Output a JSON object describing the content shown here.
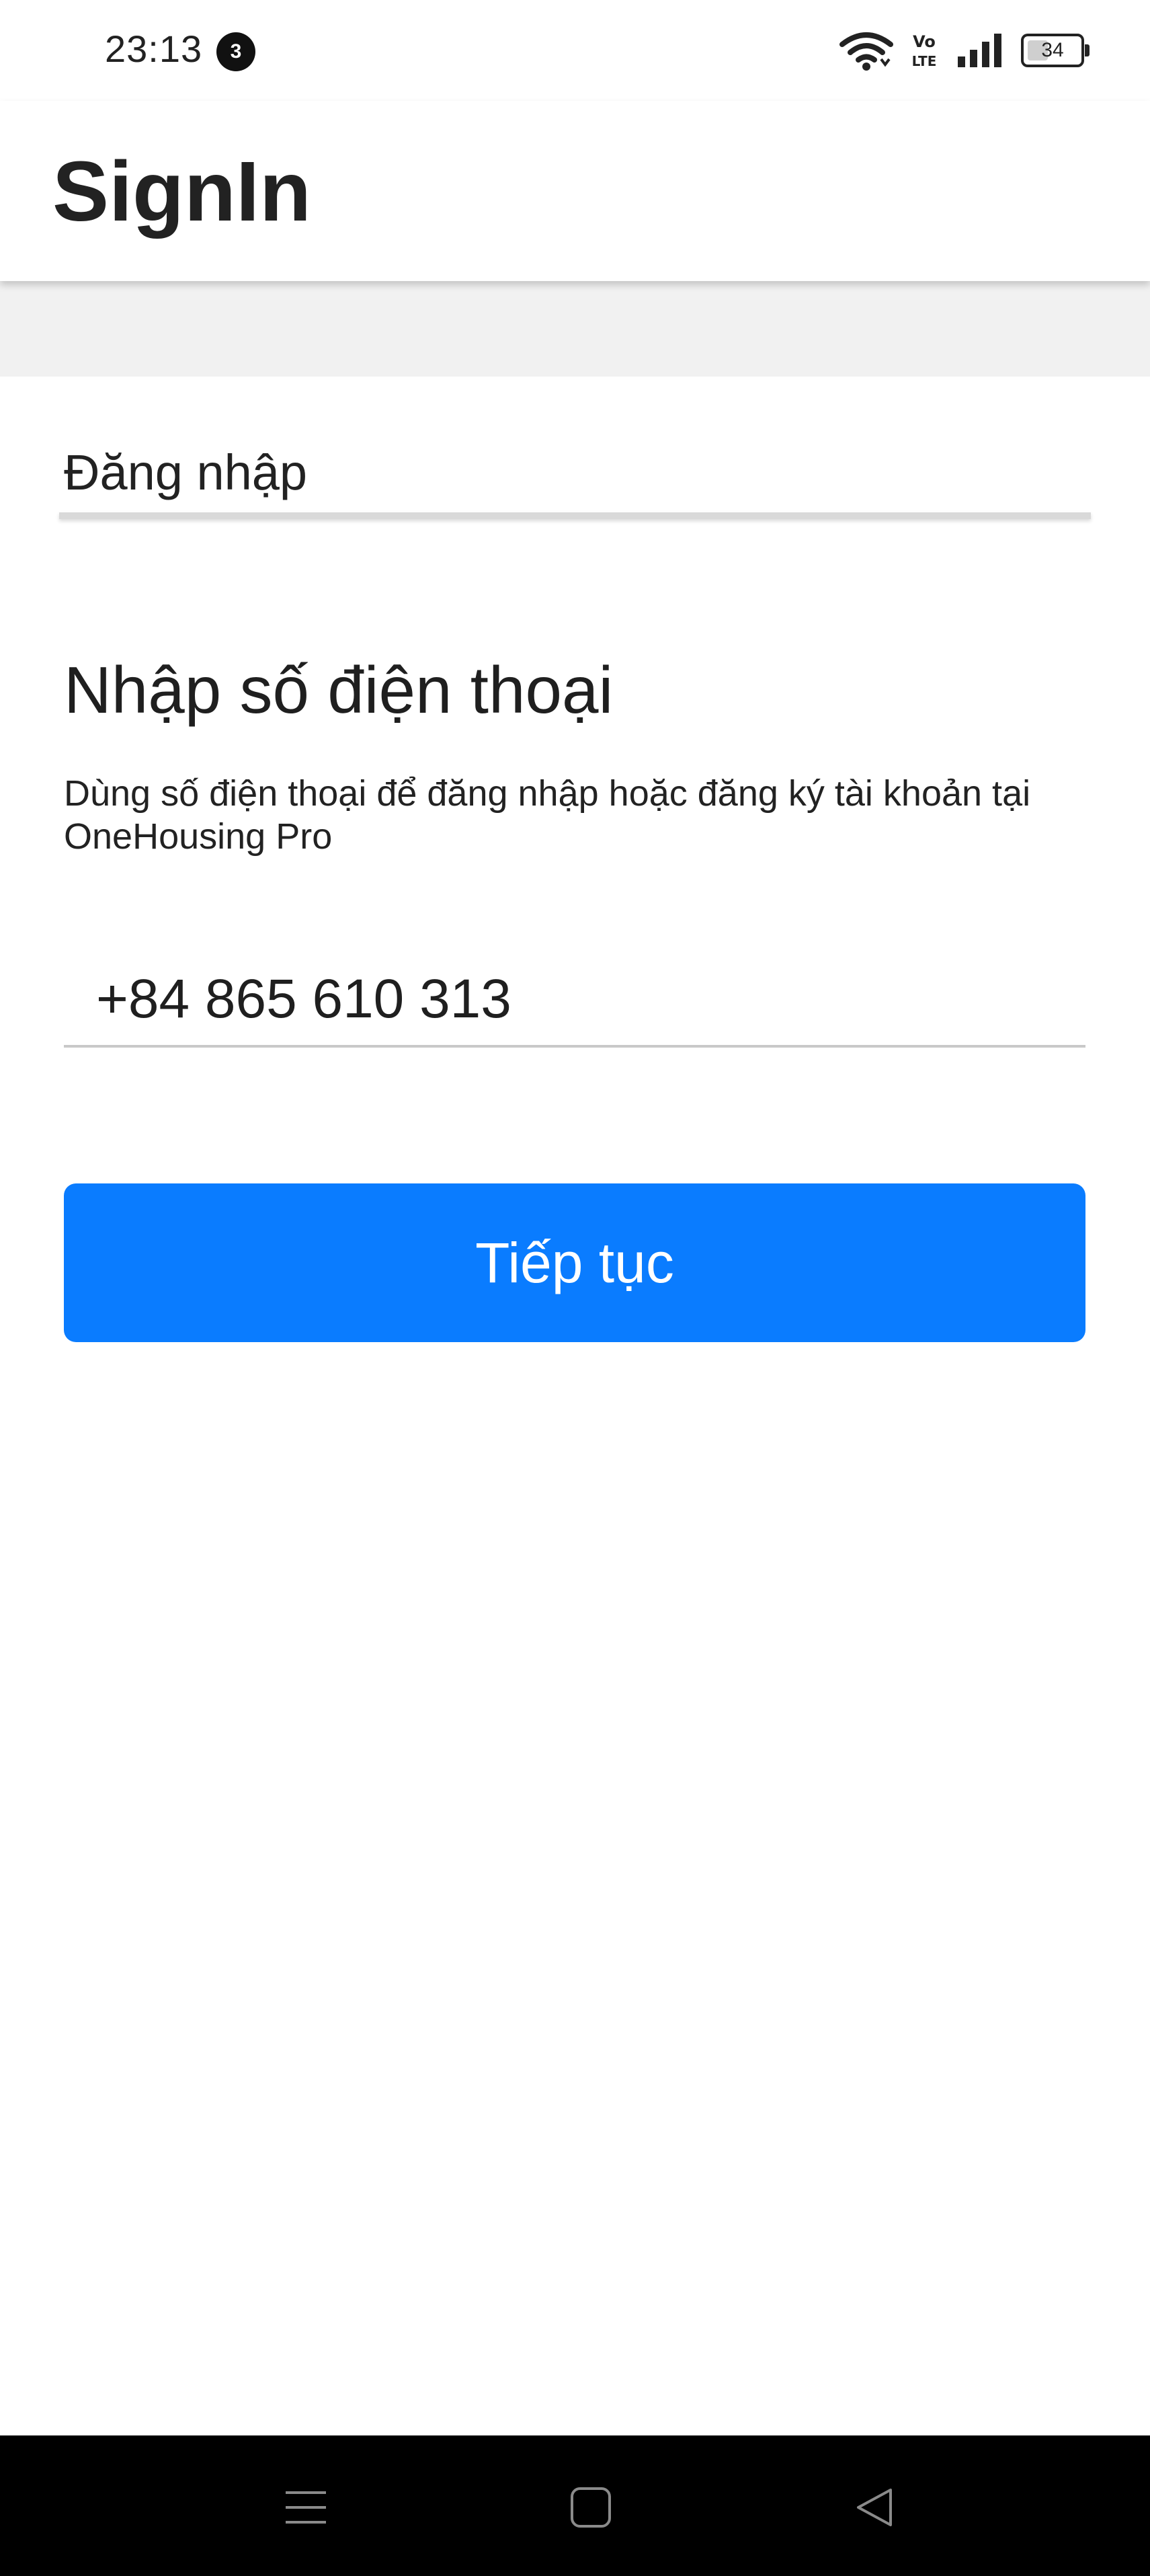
{
  "status_bar": {
    "time": "23:13",
    "notification_count": "3",
    "volte_label_top": "Vo",
    "volte_label_bottom": "LTE",
    "battery_level": "34",
    "icons": [
      "wifi-icon",
      "volte-icon",
      "signal-icon",
      "battery-icon"
    ]
  },
  "app_bar": {
    "title": "SignIn"
  },
  "tab": {
    "label": "Đăng nhập"
  },
  "form": {
    "heading": "Nhập số điện thoại",
    "description": "Dùng số điện thoại để đăng nhập hoặc đăng ký tài khoản tại OneHousing Pro",
    "phone_value": "+84 865 610 313",
    "continue_label": "Tiếp tục"
  },
  "nav_bar": {
    "icons": [
      "menu-icon",
      "home-icon",
      "back-icon"
    ]
  },
  "colors": {
    "primary": "#0a7cff",
    "band": "#f1f1f1",
    "nav_background": "#000000"
  }
}
